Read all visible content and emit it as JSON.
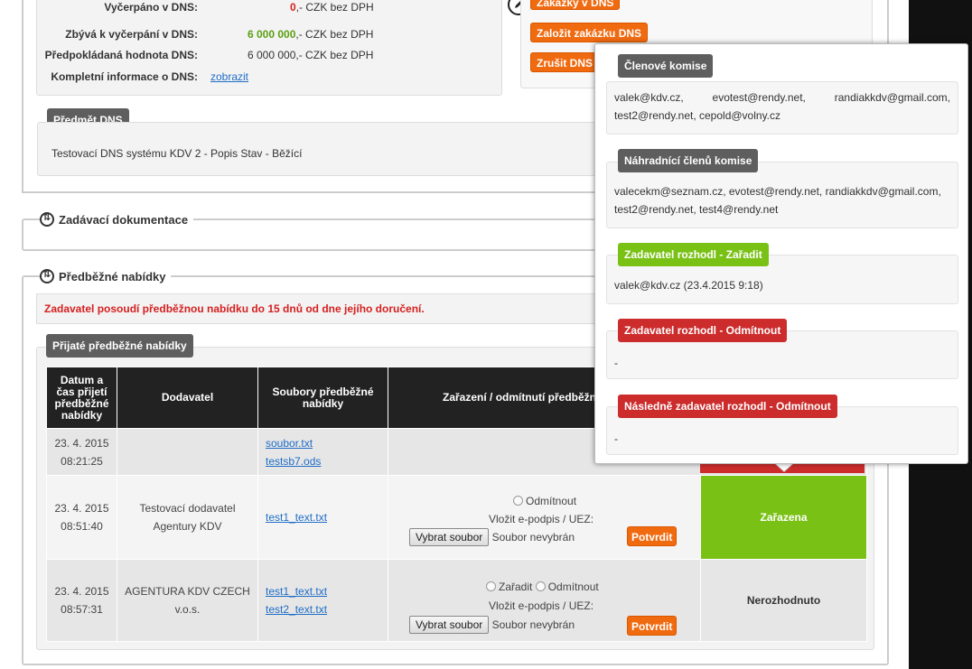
{
  "dns_info": {
    "rows": [
      {
        "label": "Vyčerpáno v DNS:",
        "value": "0",
        "suffix": ",- CZK bez DPH"
      },
      {
        "label": "Zbývá k vyčerpání v DNS:",
        "value": "6 000 000",
        "suffix": ",- CZK bez DPH"
      },
      {
        "label": "Předpokládaná hodnota DNS:",
        "value": "6 000 000,- CZK bez DPH"
      },
      {
        "label": "Kompletní informace o DNS:",
        "link": "zobrazit"
      }
    ]
  },
  "actions": {
    "orders": "Zakázky v DNS",
    "create_order": "Založit zakázku DNS",
    "cancel": "Zrušit DNS"
  },
  "subject": {
    "heading": "Předmět DNS",
    "text": "Testovací DNS systému KDV 2 - Popis Stav - Běžící"
  },
  "sections": {
    "docs": "Zadávací dokumentace",
    "preliminary": "Předběžné nabídky"
  },
  "notice": "Zadavatel posoudí předběžnou nabídku do 15 dnů od dne jejího doručení.",
  "offers": {
    "heading": "Přijaté předběžné nabídky",
    "columns": [
      "Datum a čas přijetí předběžné nabídky",
      "Dodavatel",
      "Soubory předběžné nabídky",
      "Zařazení / odmítnutí předběžné"
    ],
    "rows": [
      {
        "date": "23. 4. 2015",
        "time": "08:21:25",
        "supplier_1": "",
        "supplier_2": "",
        "file_1": "soubor.txt",
        "file_2": "testsb7.ods"
      },
      {
        "date": "23. 4. 2015",
        "time": "08:51:40",
        "supplier_1": "Testovací dodavatel",
        "supplier_2": "Agentury KDV",
        "file_1": "test1_text.txt",
        "option_reject": "Odmítnout",
        "sign_label": "Vložit e-podpis / UEZ:",
        "file_button": "Vybrat soubor",
        "file_status": "Soubor nevybrán",
        "confirm": "Potvrdit",
        "state": "Zařazena"
      },
      {
        "date": "23. 4. 2015",
        "time": "08:57:31",
        "supplier_1": "AGENTURA KDV CZECH",
        "supplier_2": "v.o.s.",
        "file_1": "test1_text.txt",
        "file_2": "test2_text.txt",
        "option_accept": "Zařadit",
        "option_reject": "Odmítnout",
        "sign_label": "Vložit e-podpis / UEZ:",
        "file_button": "Vybrat soubor",
        "file_status": "Soubor nevybrán",
        "confirm": "Potvrdit",
        "state": "Nerozhodnuto"
      }
    ]
  },
  "popover": {
    "members_heading": "Členové komise",
    "members_line1_a": "valek@kdv.cz,",
    "members_line1_b": "evotest@rendy.net,",
    "members_line1_c": "randiakkdv@gmail.com,",
    "members_line2": "test2@rendy.net, cepold@volny.cz",
    "subs_heading": "Náhradnící členů komise",
    "subs_line1": "valecekm@seznam.cz, evotest@rendy.net, randiakkdv@gmail.com,",
    "subs_line2": "test2@rendy.net, test4@rendy.net",
    "accept_heading": "Zadavatel rozhodl - Zařadit",
    "accept_text": "valek@kdv.cz (23.4.2015 9:18)",
    "reject_heading": "Zadavatel rozhodl - Odmítnout",
    "reject_text": "-",
    "later_heading": "Následně zadavatel rozhodl - Odmítnout",
    "later_text": "-"
  },
  "colors": {
    "accent_orange": "#f06a10",
    "accept_green": "#7ac116",
    "reject_red": "#cc2c2c",
    "header_dark": "#222222"
  }
}
